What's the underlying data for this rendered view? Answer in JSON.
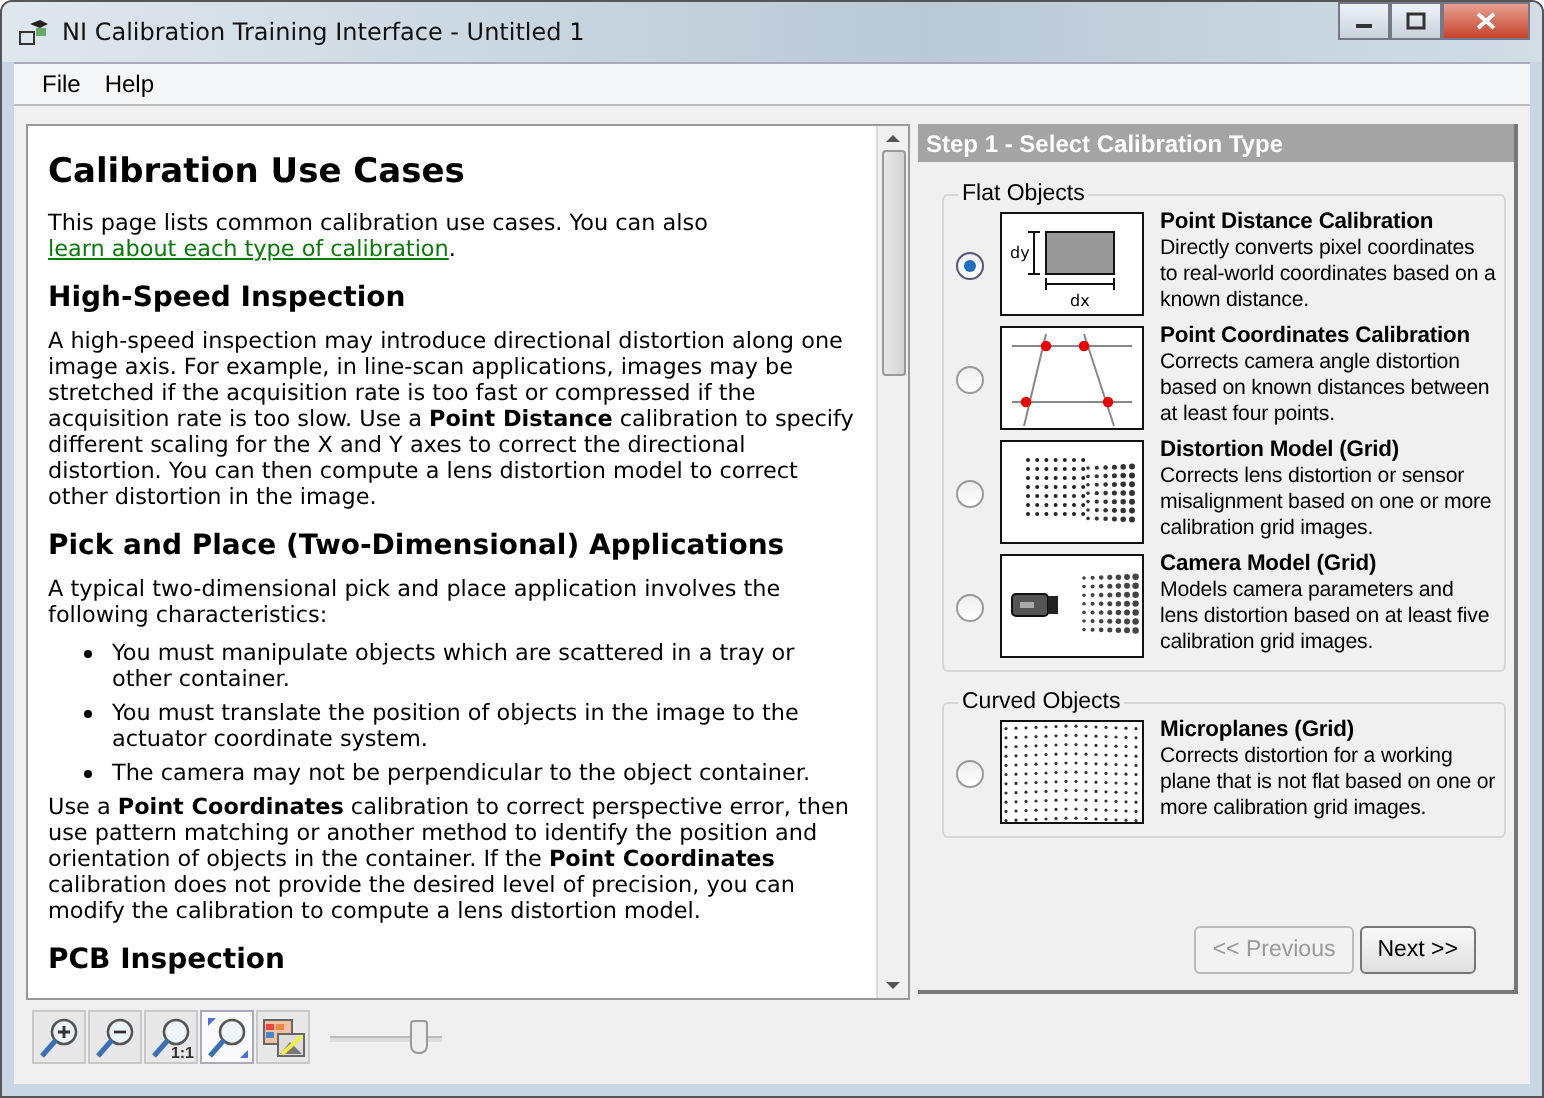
{
  "window": {
    "title": "NI Calibration Training Interface - Untitled 1"
  },
  "menu": [
    {
      "label": "File"
    },
    {
      "label": "Help"
    }
  ],
  "document": {
    "title": "Calibration Use Cases",
    "intro": "This page lists common calibration use cases. You can also ",
    "intro_link": "learn about each type of calibration",
    "intro_end": ".",
    "sections": [
      {
        "heading": "High-Speed Inspection",
        "blocks": [
          {
            "kind": "paragraph",
            "text": "A high-speed inspection may introduce directional distortion along one image axis. For example, in line-scan applications, images may be stretched if the acquisition rate is too fast or compressed if the acquisition rate is too slow. Use a **Point Distance** calibration to specify different scaling for the X and Y axes to correct the directional distortion. You can then compute a lens distortion model to correct other distortion in the image."
          }
        ]
      },
      {
        "heading": "Pick and Place (Two-Dimensional) Applications",
        "blocks": [
          {
            "kind": "paragraph",
            "text": "A typical two-dimensional pick and place application involves the following characteristics:"
          },
          {
            "kind": "list",
            "items": [
              "You must manipulate objects which are scattered in a tray or other container.",
              "You must translate the position of objects in the image to the actuator coordinate system.",
              "The camera may not be perpendicular to the object container."
            ]
          },
          {
            "kind": "paragraph",
            "text": "Use a **Point Coordinates** calibration to correct perspective error, then use pattern matching or another method to identify the position and orientation of objects in the container. If the **Point Coordinates** calibration does not provide the desired level of precision, you can modify the calibration to compute a lens distortion model."
          }
        ]
      },
      {
        "heading": "PCB Inspection"
      }
    ]
  },
  "toolbar": {
    "tools": [
      {
        "kind": "zoom-in",
        "selected": false
      },
      {
        "kind": "zoom-out",
        "selected": false
      },
      {
        "kind": "zoom-actual",
        "badge": "1:1",
        "selected": false
      },
      {
        "kind": "zoom-fit",
        "selected": true
      },
      {
        "kind": "palette",
        "selected": false
      }
    ],
    "slider": {
      "level": 0.88
    }
  },
  "wizard": {
    "step_title": "Step 1 - Select Calibration Type",
    "groups": [
      {
        "title": "Flat Objects",
        "options": [
          {
            "kind": "point-distance",
            "title": "Point Distance Calibration",
            "description": "Directly converts pixel coordinates to real-world coordinates based on a known distance.",
            "selected": true,
            "labels": [
              "dy",
              "dx"
            ]
          },
          {
            "kind": "point-coordinates",
            "title": "Point Coordinates Calibration",
            "description": "Corrects camera angle distortion based on known distances between at least four points.",
            "selected": false
          },
          {
            "kind": "distortion-grid",
            "title": "Distortion Model (Grid)",
            "description": "Corrects lens distortion or sensor misalignment based on one or more calibration grid images.",
            "selected": false
          },
          {
            "kind": "camera-grid",
            "title": "Camera Model (Grid)",
            "description": "Models camera parameters and lens distortion based on at least five calibration grid images.",
            "selected": false
          }
        ]
      },
      {
        "title": "Curved Objects",
        "options": [
          {
            "kind": "microplanes",
            "title": "Microplanes (Grid)",
            "description": "Corrects distortion for a working plane that is not flat based on one or more calibration grid images.",
            "selected": false
          }
        ]
      }
    ],
    "buttons": [
      {
        "label": "<< Previous",
        "disabled": true
      },
      {
        "label": "Next >>",
        "disabled": false
      }
    ]
  }
}
